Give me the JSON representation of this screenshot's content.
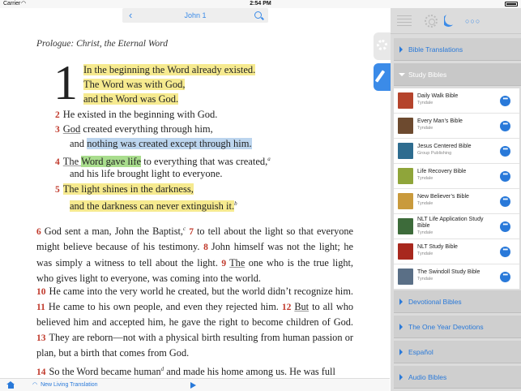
{
  "status_bar": {
    "carrier": "Carrier",
    "time": "2:54 PM"
  },
  "reader": {
    "reference": "John 1",
    "heading": "Prologue: Christ, the Eternal Word",
    "drop_cap": "1",
    "poetry": [
      {
        "num": "",
        "text": "In the beginning the Word already existed.",
        "highlight": "yellow"
      },
      {
        "num": "",
        "text": "The Word was with God,",
        "highlight": "yellow"
      },
      {
        "num": "",
        "text": "and the Word was God.",
        "highlight": "yellow"
      },
      {
        "num": "2",
        "text": "He existed in the beginning with God."
      },
      {
        "num": "3",
        "pre": "God",
        "text": " created everything through him,"
      },
      {
        "num": "",
        "pre": "and ",
        "text": "nothing was created except through him.",
        "highlight": "blue"
      },
      {
        "num": "4",
        "pre": "The ",
        "text": "Word gave life",
        "post": " to everything that was created,",
        "footnote": "a",
        "highlight": "green"
      },
      {
        "num": "",
        "text": "and his life brought light to everyone."
      },
      {
        "num": "5",
        "text": "The light shines in the darkness,",
        "highlight": "yellow"
      },
      {
        "num": "",
        "text": "and the darkness can never extinguish it.",
        "footnote": "b",
        "highlight": "yellow"
      }
    ],
    "para1": {
      "v6": "6",
      "t6": "God sent a man, John the Baptist,",
      "fn6": "c",
      "v7": "7",
      "t7": "to tell about the light so that everyone might believe because of his testimony.",
      "v8": "8",
      "t8": "John himself was not the light; he was simply a witness to tell about the light.",
      "v9": "9",
      "t9a": "The",
      "t9b": "one who is the true light, who gives light to everyone, was coming into the world."
    },
    "para2": {
      "v10": "10",
      "t10": "He came into the very world he created, but the world didn’t recognize him.",
      "v11": "11",
      "t11": "He came to his own people, and even they rejected him.",
      "v12": "12",
      "t12a": "But",
      "t12b": "to all who believed him and accepted him, he gave the right to become children of God.",
      "v13": "13",
      "t13": "They are reborn—not with a physical birth resulting from human passion or plan, but a birth that comes from God."
    },
    "para3": {
      "v14": "14",
      "t14a": "So the Word became human",
      "fn14": "d",
      "t14b": "and made his home among us. He was full"
    }
  },
  "bottom_bar": {
    "translation": "New Living Translation"
  },
  "panel": {
    "sections_top": [
      {
        "label": "Bible Translations",
        "open": false
      },
      {
        "label": "Study Bibles",
        "open": true
      }
    ],
    "bibles": [
      {
        "title": "Daily Walk Bible",
        "publisher": "Tyndale",
        "color": "#b5442c",
        "two_line": false
      },
      {
        "title": "Every Man’s Bible",
        "publisher": "Tyndale",
        "color": "#6d4a2f",
        "two_line": false
      },
      {
        "title": "Jesus Centered Bible",
        "publisher": "Group Publishing",
        "color": "#2e6c8f",
        "two_line": false
      },
      {
        "title": "Life Recovery Bible",
        "publisher": "Tyndale",
        "color": "#8fa53a",
        "two_line": false
      },
      {
        "title": "New Believer’s Bible",
        "publisher": "Tyndale",
        "color": "#c99a3c",
        "two_line": false
      },
      {
        "title": "NLT Life Application Study Bible",
        "publisher": "Tyndale",
        "color": "#3d6b3a",
        "two_line": true
      },
      {
        "title": "NLT Study Bible",
        "publisher": "Tyndale",
        "color": "#a8281e",
        "two_line": false
      },
      {
        "title": "The Swindoll Study Bible",
        "publisher": "Tyndale",
        "color": "#5a6f86",
        "two_line": false
      }
    ],
    "sections_bottom": [
      {
        "label": "Devotional Bibles"
      },
      {
        "label": "The One Year Devotions"
      },
      {
        "label": "Español"
      },
      {
        "label": "Audio Bibles"
      }
    ]
  },
  "colors": {
    "accent": "#2979d9",
    "highlight_yellow": "#f6ea8f",
    "highlight_blue": "#bcd5ee",
    "highlight_green": "#a9dd8d",
    "verse_number": "#c0392b"
  },
  "icons": [
    "home-icon",
    "wifi-icon",
    "play-icon",
    "back-icon",
    "search-icon",
    "gear-icon",
    "pen-icon",
    "menu-icon",
    "sun-icon",
    "moon-icon",
    "more-icon",
    "battery-icon"
  ]
}
